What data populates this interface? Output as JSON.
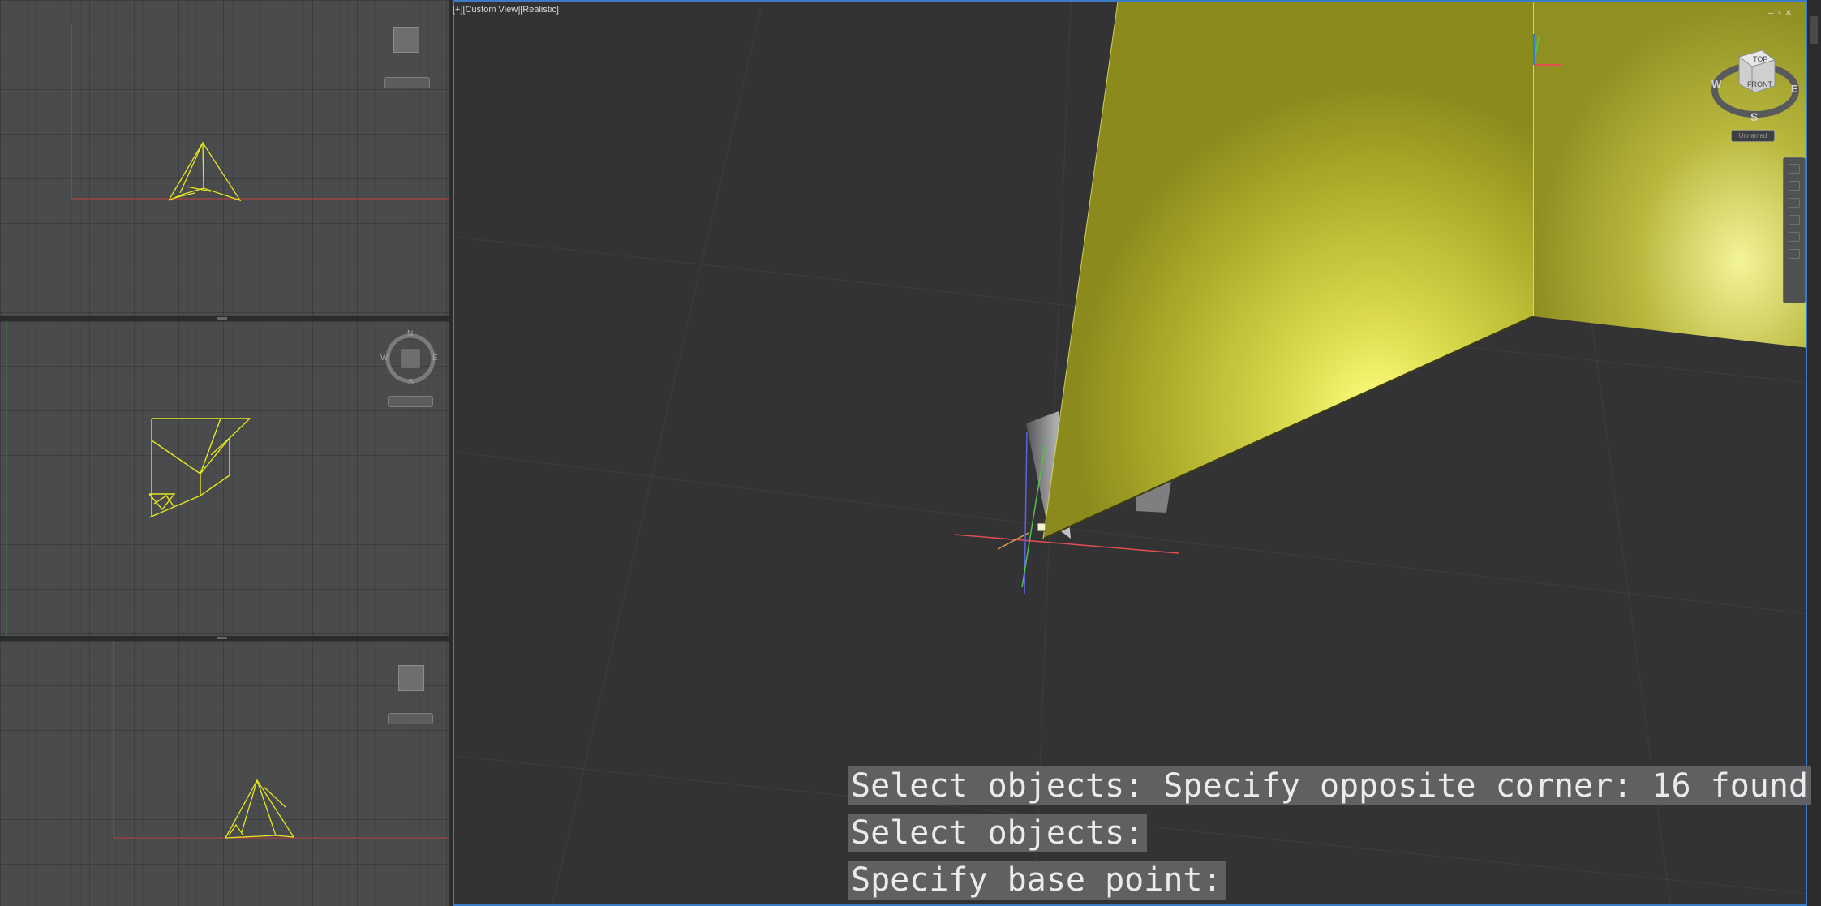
{
  "main_viewport": {
    "label": "[+][Custom View][Realistic]",
    "window_controls": {
      "minimize": "–",
      "restore": "▫",
      "close": "✕"
    }
  },
  "viewcube": {
    "top_face": "TOP",
    "front_face": "FRONT",
    "north": "",
    "south": "S",
    "east": "E",
    "west": "W",
    "wcs_menu": "Unnamed"
  },
  "small_viewports": {
    "top": {
      "cube_face": "",
      "wcs_menu": ""
    },
    "middle": {
      "compass": {
        "north": "N",
        "south": "S",
        "east": "E",
        "west": "W"
      },
      "cube_face": "",
      "wcs_menu": ""
    },
    "bottom": {
      "cube_face": "",
      "wcs_menu": ""
    }
  },
  "command_lines": [
    "Select objects: Specify opposite corner: 16 found",
    "Select objects:",
    "Specify base point:"
  ],
  "colors": {
    "accent_border": "#3b7cc4",
    "wireframe": "#e6e620",
    "surface": "#c9c93a",
    "x_axis": "#e05050",
    "y_axis": "#50c050",
    "z_axis": "#6060e0"
  },
  "icons": {
    "minimize": "minimize-icon",
    "restore": "restore-icon",
    "close": "close-icon",
    "ucs": "ucs-icon",
    "grip": "grip-icon"
  }
}
